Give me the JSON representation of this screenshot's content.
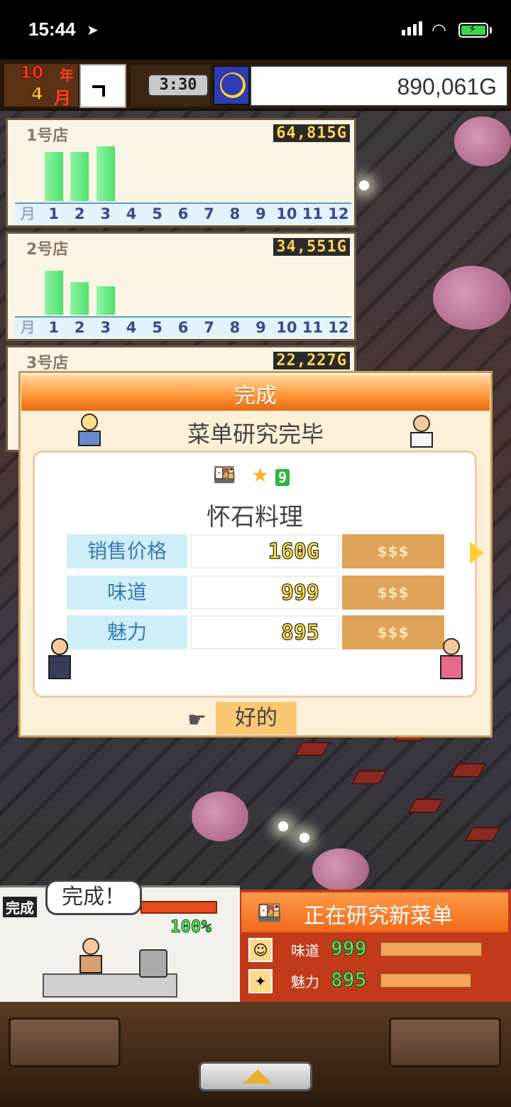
{
  "status_bar": {
    "time": "15:44",
    "location_icon": "location-arrow-icon"
  },
  "hud": {
    "year": "10",
    "year_unit": "年",
    "month": "4",
    "month_unit": "月",
    "game_time": "3:30",
    "money": "890,061G"
  },
  "stores": [
    {
      "name": "1号店",
      "sales": "64,815G",
      "monthly": [
        0.82,
        0.82,
        0.92,
        0,
        0,
        0,
        0,
        0,
        0,
        0,
        0,
        0
      ]
    },
    {
      "name": "2号店",
      "sales": "34,551G",
      "monthly": [
        0.74,
        0.55,
        0.48,
        0,
        0,
        0,
        0,
        0,
        0,
        0,
        0,
        0
      ]
    },
    {
      "name": "3号店",
      "sales": "22,227G"
    }
  ],
  "axis_labels": [
    "月",
    "1",
    "2",
    "3",
    "4",
    "5",
    "6",
    "7",
    "8",
    "9",
    "10",
    "11",
    "12"
  ],
  "dialog": {
    "title": "完成",
    "subtitle": "菜单研究完毕",
    "dish_level": "9",
    "dish_name": "怀石料理",
    "rows": [
      {
        "label": "销售价格",
        "value": "160G",
        "cost": "$$$"
      },
      {
        "label": "味道",
        "value": "999",
        "cost": "$$$"
      },
      {
        "label": "魅力",
        "value": "895",
        "cost": "$$$"
      }
    ],
    "ok_label": "好的"
  },
  "kitchen": {
    "tag": "完成",
    "bubble": "完成！",
    "progress": "100%",
    "progress_value": 1.0
  },
  "research": {
    "title": "正在研究新菜单",
    "taste_label": "味道",
    "taste_value": "999",
    "taste_fill": 0.95,
    "charm_label": "魅力",
    "charm_value": "895",
    "charm_fill": 0.85
  },
  "colors": {
    "accent_orange": "#ef6a1a",
    "bar_green": "#4fe06e",
    "money_text": "#333333"
  }
}
